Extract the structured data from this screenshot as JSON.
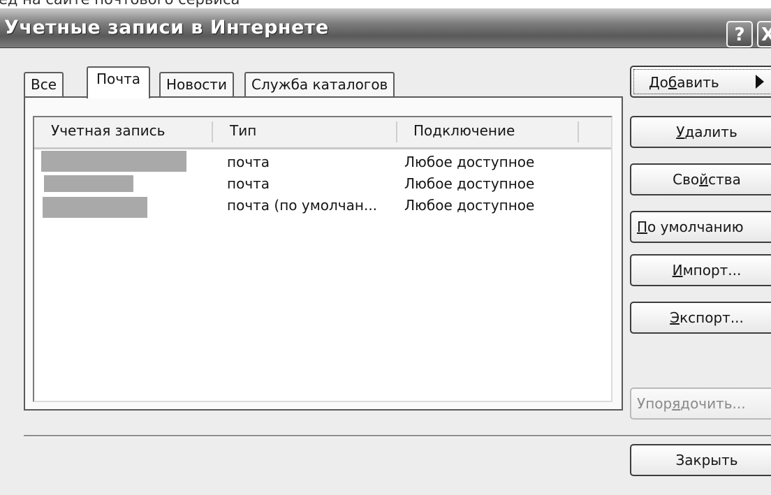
{
  "window": {
    "title": "Учетные записи в Интернете",
    "help_glyph": "?",
    "close_glyph": "X",
    "top_strip_text": "ед на сайте почтового сервиса"
  },
  "tabs": [
    {
      "label": "Все",
      "active": false
    },
    {
      "label": "Почта",
      "active": true
    },
    {
      "label": "Новости",
      "active": false
    },
    {
      "label": "Служба каталогов",
      "active": false
    }
  ],
  "list": {
    "columns": [
      "Учетная запись",
      "Тип",
      "Подключение"
    ],
    "rows": [
      {
        "account": "",
        "type": "почта",
        "connection": "Любое доступное"
      },
      {
        "account": "",
        "type": "почта",
        "connection": "Любое доступное"
      },
      {
        "account": "",
        "type": "почта (по умолчан...",
        "connection": "Любое доступное"
      }
    ]
  },
  "buttons": {
    "add": {
      "pre": "До",
      "hot": "б",
      "post": "авить"
    },
    "remove": {
      "pre": "",
      "hot": "У",
      "post": "далить"
    },
    "properties": {
      "pre": "Сво",
      "hot": "й",
      "post": "ства"
    },
    "default": {
      "pre": "",
      "hot": "П",
      "post": "о умолчанию"
    },
    "import": {
      "pre": "",
      "hot": "И",
      "post": "мпорт..."
    },
    "export": {
      "pre": "",
      "hot": "Э",
      "post": "кспорт..."
    },
    "order": {
      "pre": "Упор",
      "hot": "я",
      "post": "дочить..."
    },
    "close": {
      "pre": "",
      "hot": "",
      "post": "Закрыть"
    }
  }
}
